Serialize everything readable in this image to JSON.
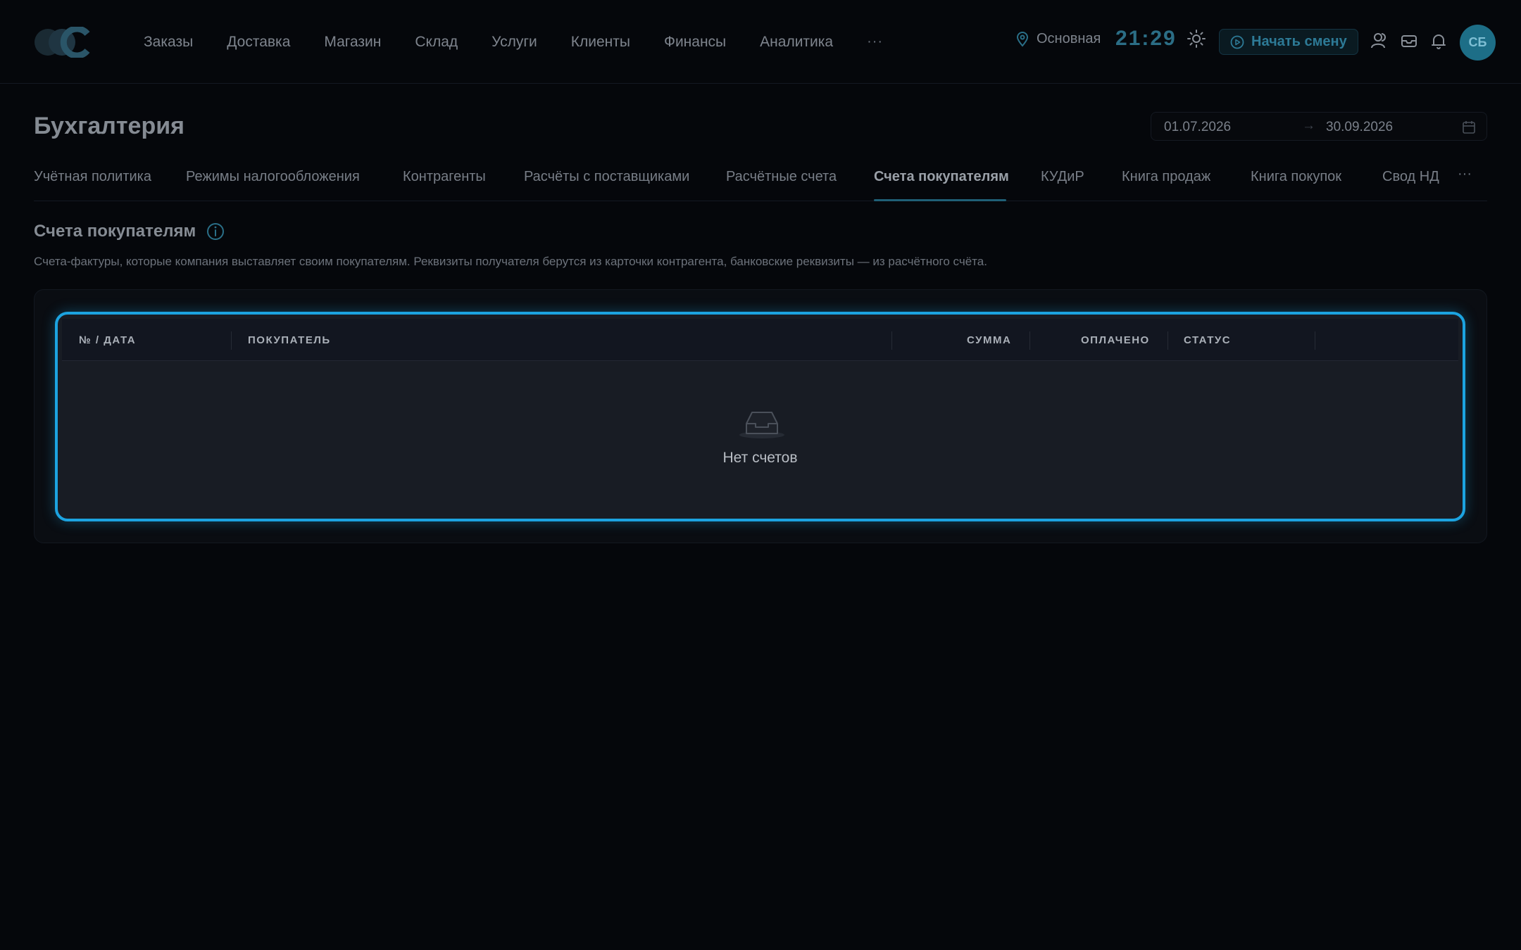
{
  "nav": {
    "items": [
      "Заказы",
      "Доставка",
      "Магазин",
      "Склад",
      "Услуги",
      "Клиенты",
      "Финансы",
      "Аналитика"
    ],
    "more": "···",
    "location": "Основная",
    "clock": "21:29",
    "shift_button": "Начать смену",
    "avatar_initials": "СБ",
    "icons": [
      "map-pin-icon",
      "sun-icon",
      "play-circle-icon",
      "users-icon",
      "inbox-icon",
      "bell-icon"
    ]
  },
  "page": {
    "title": "Бухгалтерия",
    "date_from": "01.07.2026",
    "date_arrow": "→",
    "date_to": "30.09.2026"
  },
  "tabs": {
    "items": [
      "Учётная политика",
      "Режимы налогообложения",
      "Контрагенты",
      "Расчёты с поставщиками",
      "Расчётные счета",
      "Счета покупателям",
      "КУДиР",
      "Книга продаж",
      "Книга покупок",
      "Свод НД"
    ],
    "active": "Счета покупателям",
    "more": "···"
  },
  "section": {
    "title": "Счета покупателям",
    "description": "Счета-фактуры, которые компания выставляет своим покупателям. Реквизиты получателя берутся из карточки контрагента, банковские реквизиты — из расчётного счёта."
  },
  "table": {
    "columns": [
      "№ / ДАТА",
      "ПОКУПАТЕЛЬ",
      "СУММА",
      "ОПЛАЧЕНО",
      "СТАТУС"
    ],
    "rows": [],
    "empty_text": "Нет счетов"
  },
  "colors": {
    "accent": "#1ca3e0",
    "brand": "#1d6e87",
    "background": "#05070b"
  }
}
